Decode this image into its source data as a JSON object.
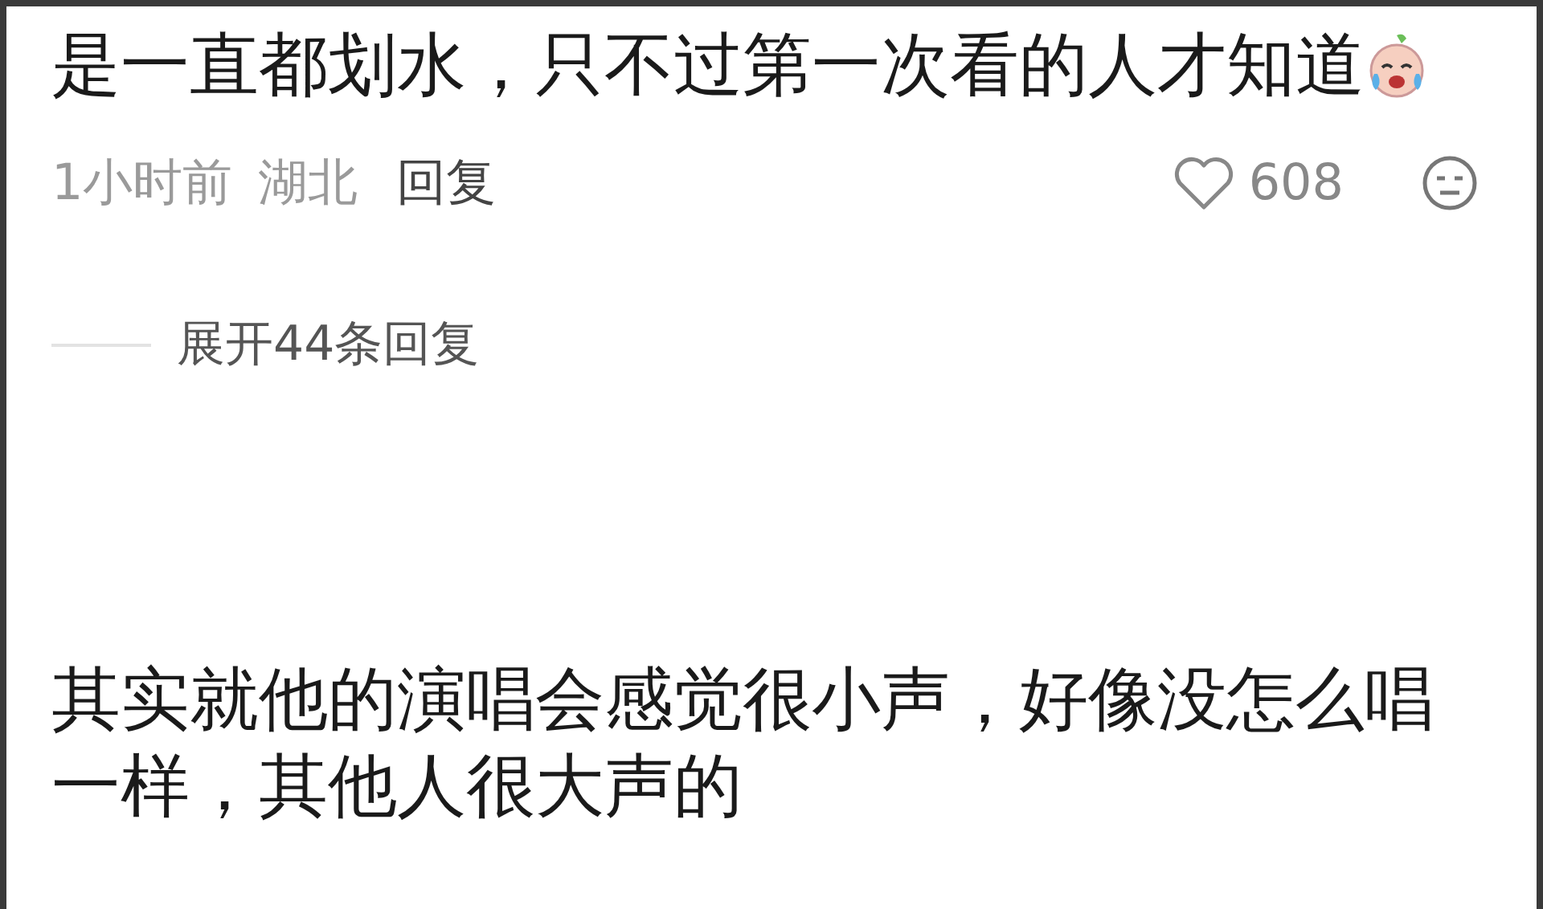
{
  "comments": [
    {
      "text": "是一直都划水，只不过第一次看的人才知道",
      "has_emoji": true,
      "time": "1小时前",
      "location": "湖北",
      "reply_label": "回复",
      "likes": "608",
      "expand_label": "展开44条回复"
    },
    {
      "text": "其实就他的演唱会感觉很小声，好像没怎么唱一样，其他人很大声的"
    }
  ]
}
